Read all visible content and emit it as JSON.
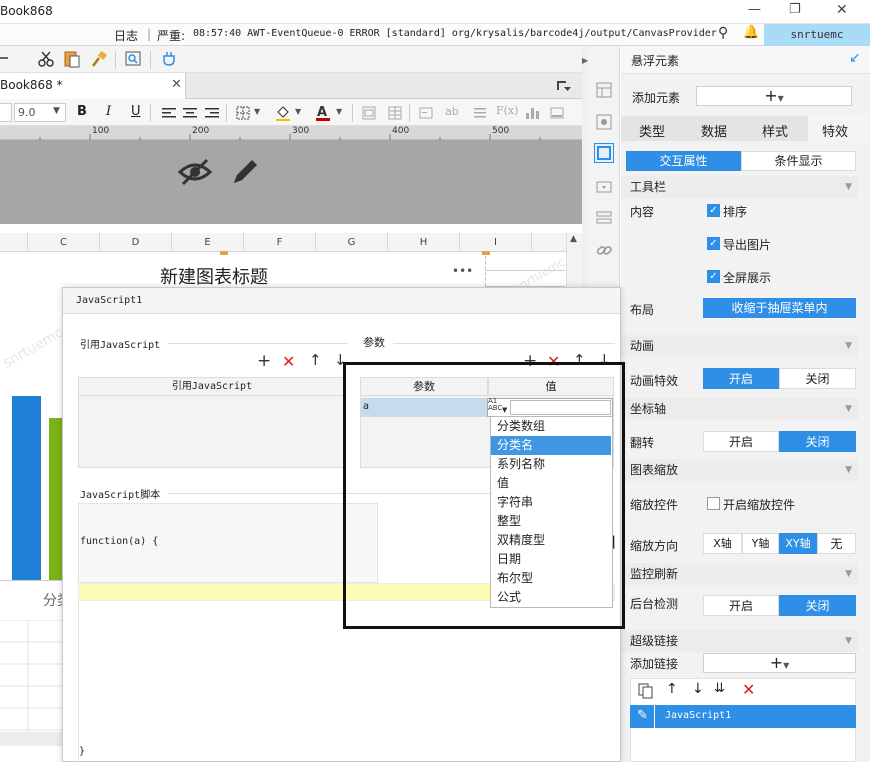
{
  "window": {
    "title": "Book868",
    "controls": [
      "—",
      "❐",
      "✕"
    ]
  },
  "logbar": {
    "log_label": "日志",
    "severity": "严重:",
    "message": "08:57:40 AWT-EventQueue-0 ERROR [standard] org/krysalis/barcode4j/output/CanvasProvider",
    "user": "snrtuemc"
  },
  "doc_tab": {
    "name": "Book868 *"
  },
  "format_toolbar": {
    "font_size": "9.0",
    "bold": "B",
    "italic": "I",
    "underline": "U"
  },
  "ruler": {
    "ticks": [
      "100",
      "200",
      "300",
      "400",
      "500"
    ]
  },
  "sheet": {
    "columns": [
      "C",
      "D",
      "E",
      "F",
      "G",
      "H",
      "I"
    ],
    "chart_title": "新建图表标题",
    "more_dots": "•••",
    "category_label": "分类",
    "watermark": "snrtuemc"
  },
  "right_panel": {
    "title": "悬浮元素",
    "add_element_label": "添加元素",
    "tabs": [
      "类型",
      "数据",
      "样式",
      "特效"
    ],
    "subtabs": [
      "交互属性",
      "条件显示"
    ],
    "toolbar_section": "工具栏",
    "content_label": "内容",
    "checkboxes": [
      "排序",
      "导出图片",
      "全屏展示"
    ],
    "layout_label": "布局",
    "layout_value": "收缩于抽屉菜单内",
    "animation_section": "动画",
    "animation_effect_label": "动画特效",
    "animation_on": "开启",
    "animation_off": "关闭",
    "axis_section": "坐标轴",
    "flip_label": "翻转",
    "flip_on": "开启",
    "flip_off": "关闭",
    "zoom_section": "图表缩放",
    "zoom_control_label": "缩放控件",
    "zoom_control_checkbox": "开启缩放控件",
    "zoom_direction_label": "缩放方向",
    "zoom_directions": [
      "X轴",
      "Y轴",
      "XY轴",
      "无"
    ],
    "monitor_section": "监控刷新",
    "background_check_label": "后台检测",
    "bg_on": "开启",
    "bg_off": "关闭",
    "hyperlink_section": "超级链接",
    "add_link_label": "添加链接",
    "link_item": "JavaScript1"
  },
  "dialog": {
    "title": "JavaScript1",
    "ref_js_group": "引用JavaScript",
    "ref_js_column": "引用JavaScript",
    "params_group": "参数",
    "param_col": "参数",
    "value_col": "值",
    "param_name": "a",
    "script_group": "JavaScript脚本",
    "script_line1": "function(a) {",
    "script_line2": "}",
    "type_options": [
      "分类数组",
      "分类名",
      "系列名称",
      "值",
      "字符串",
      "整型",
      "双精度型",
      "日期",
      "布尔型",
      "公式"
    ],
    "selected_option": "分类名"
  },
  "colors": {
    "accent": "#2f8fe6",
    "user_box": "#a9dbf7",
    "chart_blue": "#1f7fd6",
    "chart_green": "#7ab317",
    "selected_row": "#c6dcee",
    "script_highlight": "#fbfbb2"
  }
}
